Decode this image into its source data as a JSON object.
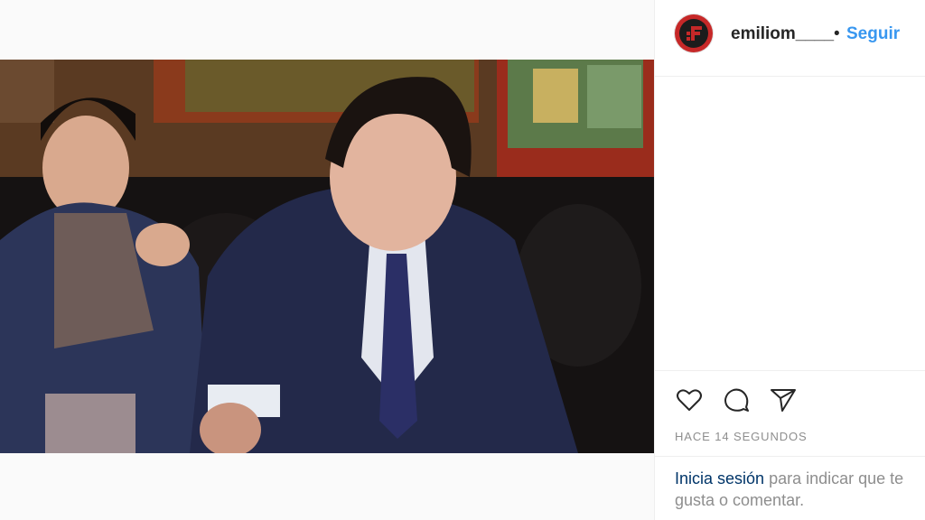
{
  "post": {
    "username": "emiliom____",
    "separator": "•",
    "follow_label": "Seguir",
    "timestamp": "HACE 14 SEGUNDOS",
    "login_link": "Inicia sesión",
    "login_text": "para indicar que te gusta o comentar."
  },
  "icons": {
    "like": "heart-icon",
    "comment": "comment-icon",
    "share": "send-icon"
  },
  "colors": {
    "link_blue": "#3897f0",
    "login_link": "#003569",
    "muted_text": "#8e8e8e",
    "avatar_red": "#c62828"
  }
}
